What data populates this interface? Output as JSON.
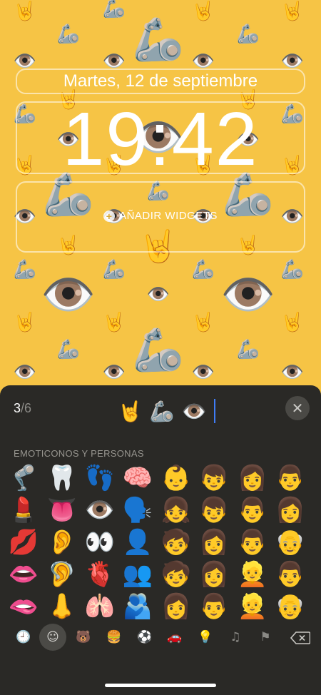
{
  "lockscreen": {
    "date": "Martes, 12 de septiembre",
    "time": "19:42",
    "add_widgets_label": "AÑADIR WIDGETS"
  },
  "wallpaper": {
    "background_color": "#f6c445",
    "emojis": [
      "🤘",
      "🦾",
      "👁️"
    ]
  },
  "emoji_picker": {
    "counter_current": "3",
    "counter_total": "/6",
    "selected_emojis": [
      "🤘",
      "🦾",
      "👁️"
    ],
    "close_icon": "close-icon",
    "section_title": "EMOTICONOS Y PERSONAS",
    "grid": [
      [
        "🦿",
        "🦷",
        "👣",
        "🧠",
        "👶",
        "👦",
        "👩",
        "👨"
      ],
      [
        "💄",
        "👅",
        "👁️",
        "🗣️",
        "👧",
        "👦",
        "👨",
        "👩"
      ],
      [
        "💋",
        "👂",
        "👀",
        "👤",
        "🧒",
        "👩",
        "👨",
        "👴"
      ],
      [
        "👄",
        "🦻",
        "🫀",
        "👥",
        "🧒",
        "👩",
        "👱",
        "👨"
      ],
      [
        "🫦",
        "👃",
        "🫁",
        "🫂",
        "👩",
        "👨",
        "👱",
        "👴"
      ]
    ],
    "categories": [
      {
        "name": "recent-icon",
        "glyph": "🕘"
      },
      {
        "name": "smileys-icon",
        "glyph": "☺"
      },
      {
        "name": "animals-icon",
        "glyph": "🐻"
      },
      {
        "name": "food-icon",
        "glyph": "🍔"
      },
      {
        "name": "activity-icon",
        "glyph": "⚽"
      },
      {
        "name": "travel-icon",
        "glyph": "🚗"
      },
      {
        "name": "objects-icon",
        "glyph": "💡"
      },
      {
        "name": "symbols-icon",
        "glyph": "♫"
      },
      {
        "name": "flags-icon",
        "glyph": "⚑"
      }
    ],
    "delete_icon": "backspace-icon"
  }
}
